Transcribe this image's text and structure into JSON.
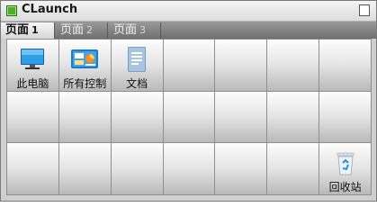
{
  "window": {
    "title": "CLaunch"
  },
  "tabs": [
    {
      "label": "页面",
      "num": "1",
      "active": true
    },
    {
      "label": "页面",
      "num": "2",
      "active": false
    },
    {
      "label": "页面",
      "num": "3",
      "active": false
    }
  ],
  "icons": {
    "this_pc": {
      "label": "此电脑",
      "icon": "monitor-icon"
    },
    "control_panel": {
      "label": "所有控制",
      "icon": "control-panel-icon"
    },
    "documents": {
      "label": "文档",
      "icon": "document-icon"
    },
    "recycle_bin": {
      "label": "回收站",
      "icon": "recycle-bin-icon"
    }
  },
  "colors": {
    "accent": "#4caf27",
    "tabbar": "#7f7f7f"
  }
}
